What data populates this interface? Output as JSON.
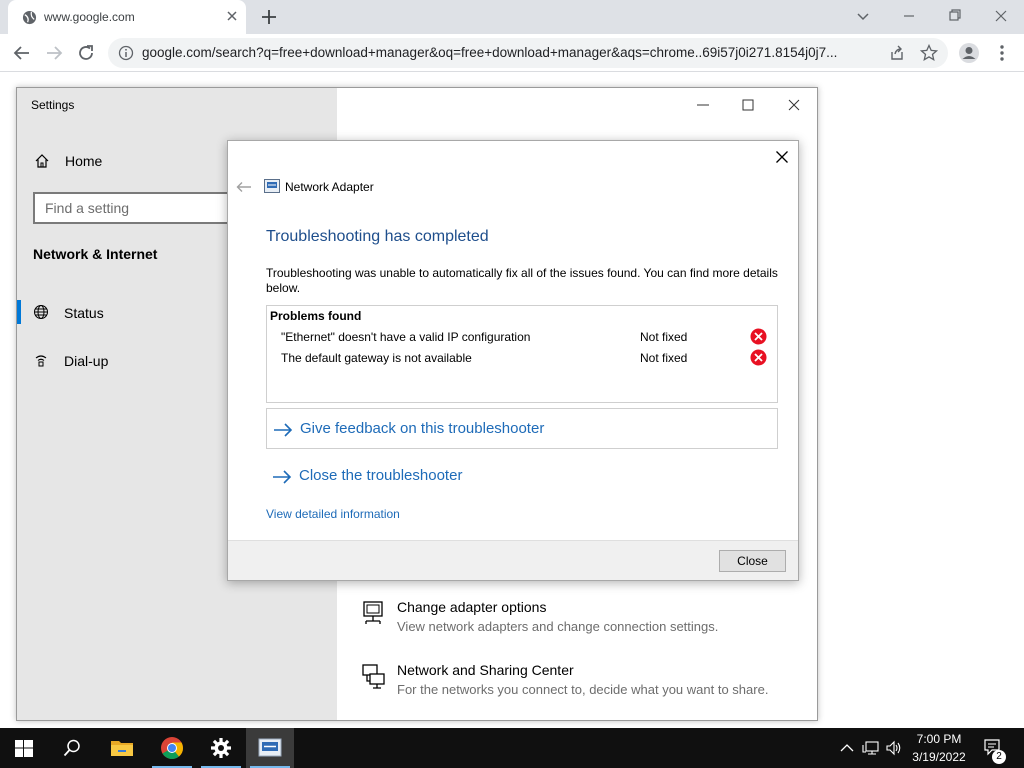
{
  "browser": {
    "tab_title": "www.google.com",
    "url": "google.com/search?q=free+download+manager&oq=free+download+manager&aqs=chrome..69i57j0i271.8154j0j7..."
  },
  "settings": {
    "window_title": "Settings",
    "home_label": "Home",
    "search_placeholder": "Find a setting",
    "section_title": "Network & Internet",
    "nav": [
      {
        "label": "Status",
        "icon": "globe-icon",
        "selected": true
      },
      {
        "label": "Dial-up",
        "icon": "dialup-icon",
        "selected": false
      }
    ],
    "options": [
      {
        "title": "Change adapter options",
        "desc": "View network adapters and change connection settings.",
        "icon": "network-adapter-icon"
      },
      {
        "title": "Network and Sharing Center",
        "desc": "For the networks you connect to, decide what you want to share.",
        "icon": "sharing-center-icon"
      }
    ]
  },
  "dialog": {
    "app_title": "Network Adapter",
    "heading": "Troubleshooting has completed",
    "description": "Troubleshooting was unable to automatically fix all of the issues found. You can find more details below.",
    "problems_header": "Problems found",
    "problems": [
      {
        "name": "\"Ethernet\" doesn't have a valid IP configuration",
        "status": "Not fixed"
      },
      {
        "name": "The default gateway is not available",
        "status": "Not fixed"
      }
    ],
    "feedback_link": "Give feedback on this troubleshooter",
    "close_link": "Close the troubleshooter",
    "details_link": "View detailed information",
    "close_button": "Close"
  },
  "taskbar": {
    "time": "7:00 PM",
    "date": "3/19/2022",
    "notification_count": "2"
  },
  "colors": {
    "accent": "#0078d7",
    "heading_blue": "#1e4e8c",
    "link_blue": "#1e6bb8",
    "error_red": "#e81123"
  }
}
